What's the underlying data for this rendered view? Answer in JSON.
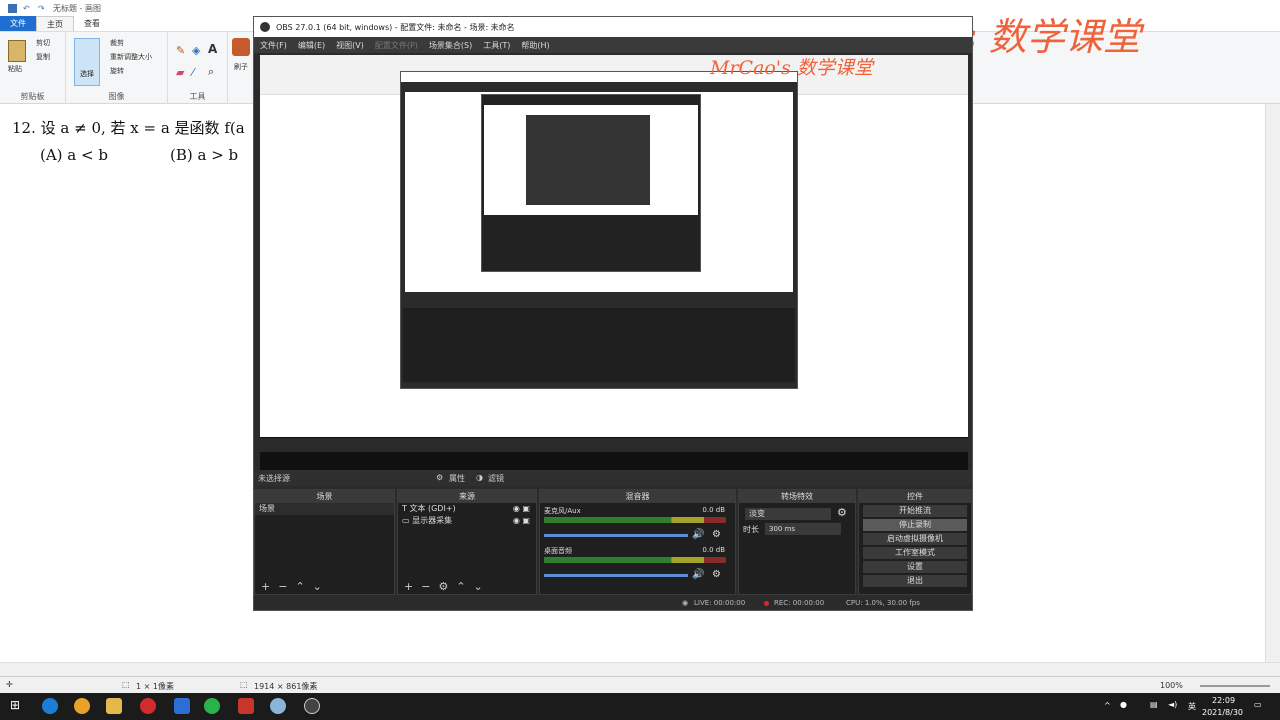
{
  "paint": {
    "title": "无标题 - 画图",
    "tabs": [
      "文件",
      "主页",
      "查看"
    ],
    "ribbon": {
      "clipboard_label": "剪贴板",
      "paste": "粘贴",
      "cut": "剪切",
      "copy": "复制",
      "image_label": "图像",
      "select": "选择",
      "crop": "裁剪",
      "resize": "重新调整大小",
      "rotate": "旋转",
      "tools_label": "工具",
      "brush": "刷子"
    },
    "status": {
      "pixel": "1 × 1像素",
      "size": "1914 × 861像素",
      "zoom": "100%"
    }
  },
  "document": {
    "line1": "12. 设 a ≠ 0, 若 x = a 是函数 f(a",
    "option_a": "(A) a < b",
    "option_b": "(B) a > b"
  },
  "watermark": {
    "text1": "MrCao's  数学课堂",
    "text2": "MrCao's  数学课堂"
  },
  "obs": {
    "title": "OBS 27.0.1 (64 bit, windows) - 配置文件: 未命名 - 场景: 未命名",
    "menu": [
      "文件(F)",
      "编辑(E)",
      "视图(V)",
      "配置文件(P)",
      "场景集合(S)",
      "工具(T)",
      "帮助(H)"
    ],
    "context": {
      "no_source": "未选择源",
      "properties": "属性",
      "filters": "滤镜"
    },
    "docks": {
      "scenes": "场景",
      "sources": "来源",
      "mixer": "混音器",
      "transitions": "转场特效",
      "controls": "控件"
    },
    "scenes": [
      "场景"
    ],
    "sources": [
      "文本 (GDI+)",
      "显示器采集"
    ],
    "mixer": [
      {
        "name": "麦克风/Aux",
        "db": "0.0 dB"
      },
      {
        "name": "桌面音频",
        "db": "0.0 dB"
      }
    ],
    "transition": {
      "type": "淡变",
      "duration_label": "时长",
      "duration": "300 ms"
    },
    "controls": [
      "开始推流",
      "停止录制",
      "启动虚拟摄像机",
      "工作室模式",
      "设置",
      "退出"
    ],
    "status": {
      "live": "LIVE: 00:00:00",
      "rec": "REC: 00:00:00",
      "cpu": "CPU: 1.0%, 30.00 fps"
    }
  },
  "taskbar": {
    "lang": "英",
    "time": "22:09",
    "date": "2021/8/30"
  }
}
